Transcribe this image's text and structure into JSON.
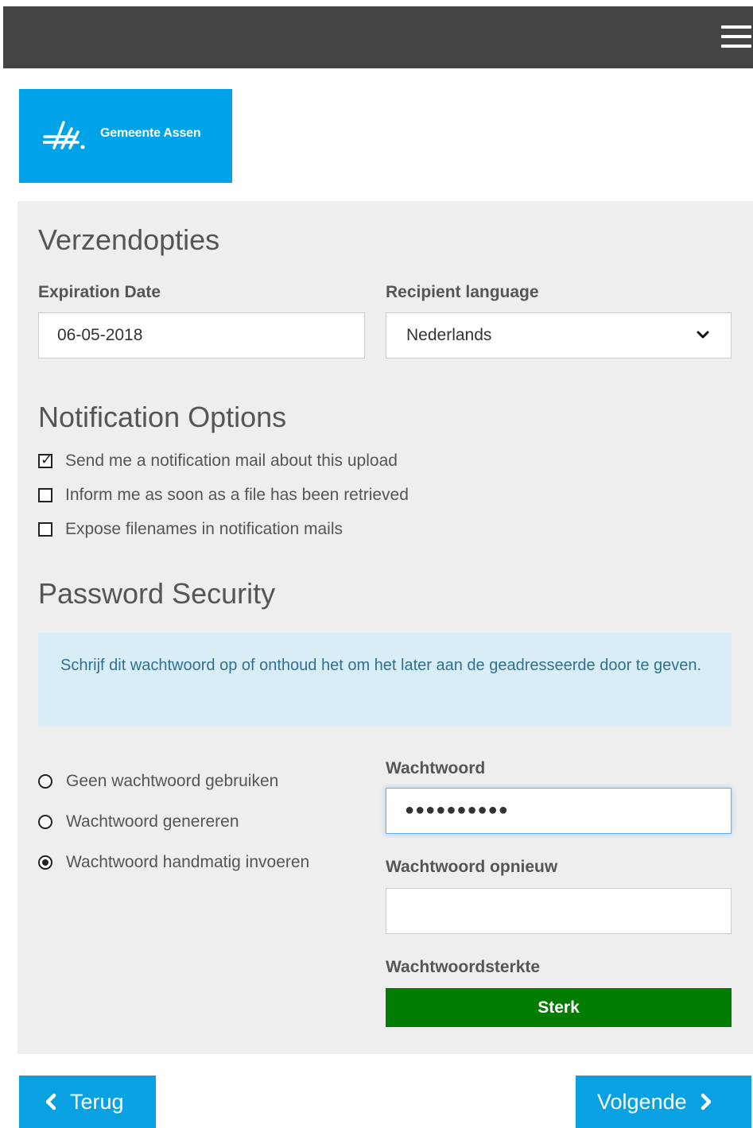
{
  "header": {
    "menu_icon": "hamburger-menu-icon"
  },
  "logo": {
    "text": "Gemeente Assen",
    "background": "#00a3e8"
  },
  "send_options": {
    "title": "Verzendopties",
    "expiration_label": "Expiration Date",
    "expiration_value": "06-05-2018",
    "language_label": "Recipient language",
    "language_value": "Nederlands"
  },
  "notifications": {
    "title": "Notification Options",
    "options": [
      {
        "label": "Send me a notification mail about this upload",
        "checked": true
      },
      {
        "label": "Inform me as soon as a file has been retrieved",
        "checked": false
      },
      {
        "label": "Expose filenames in notification mails",
        "checked": false
      }
    ]
  },
  "password": {
    "title": "Password Security",
    "info": "Schrijf dit wachtwoord op of onthoud het om het later aan de geadresseerde door te geven.",
    "radios": [
      {
        "label": "Geen wachtwoord gebruiken",
        "selected": false
      },
      {
        "label": "Wachtwoord genereren",
        "selected": false
      },
      {
        "label": "Wachtwoord handmatig invoeren",
        "selected": true
      }
    ],
    "password_label": "Wachtwoord",
    "password_mask": "●●●●●●●●●●",
    "repeat_label": "Wachtwoord opnieuw",
    "repeat_value": "",
    "strength_label": "Wachtwoordsterkte",
    "strength_value": "Sterk",
    "strength_color": "#007d00"
  },
  "nav": {
    "back_label": "Terug",
    "next_label": "Volgende",
    "button_color": "#0aa1e2"
  }
}
